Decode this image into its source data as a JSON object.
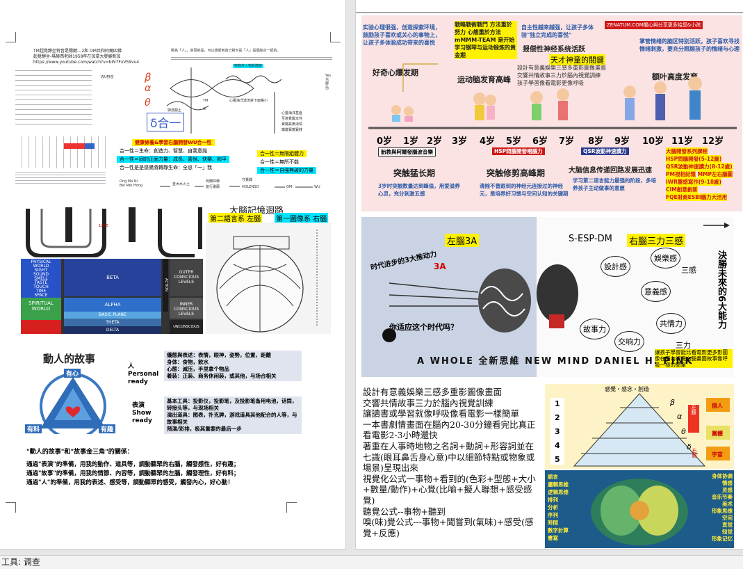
{
  "status": {
    "label": "工具: 调查"
  },
  "left_page": {
    "intro_lines": [
      "TM超覺靜坐特音是關鍵---2和 OM共和阿爾四佛",
      "超覺靜坐-瑪赫西老師1958年在加拿大發展新加",
      "https://www.youtube.com/watch?v=bW7FxV59vv4"
    ],
    "right_intro": "數為「人」，意思就是，可以感受到自己對天是「人」是個綜合一起的。",
    "highlight_note": "物物件人物質體變",
    "diagram": {
      "wu_label": "WU特音",
      "greek": [
        "β",
        "α",
        "θ"
      ],
      "center_label": "δ合一",
      "left_col": [
        "左",
        "腦",
        "知",
        "本",
        "能"
      ],
      "right_col": [
        "右",
        "腦",
        "大",
        "樓",
        "時",
        "空"
      ],
      "wave_label": "弾波靜止",
      "tm": "TM",
      "g": "G",
      "right_notes": [
        "心靈海洋波流就下面格小",
        "心靈海洋基盤",
        "至境覺醒本性",
        "寶鐵鉄無涼情",
        "鐵鍵寶鐵寶錢"
      ],
      "yes_col": [
        "Yes",
        "也",
        "野",
        "治"
      ]
    },
    "bars": [
      {
        "text": "健康修養&學習右腦開發WU合一性",
        "color": "#fff200"
      },
      {
        "text": "合一性＝生命：創造力、智慧、自我意識",
        "color": "#fff"
      },
      {
        "text": "合一性＝同的正面力量：成長、喜悅、快樂、和平",
        "color": "#00e5ff"
      },
      {
        "text": "合一性是是感覺將轉靜生命：全息「一」我",
        "color": "#fff"
      }
    ],
    "bars_right": [
      {
        "text": "合一性＝無限組體力",
        "color": "#fff200"
      },
      {
        "text": "合一性＝無所不能",
        "color": "#fff"
      },
      {
        "text": "合一性＝自強無破的力量",
        "color": "#00e5ff"
      }
    ],
    "flow": {
      "left": [
        "Ong Ma Ni",
        "Bei Mei Hong"
      ],
      "items": [
        "金木水火土",
        "阿爾四佛",
        "能行畫爾",
        "守覺觸",
        "HOLENSO",
        "OM",
        "WU"
      ]
    },
    "memory_title": "大腦記憶迴路",
    "memory_left": "第二語言系 左腦",
    "memory_right": "第一圖像系 右腦",
    "waves": {
      "physical": [
        "PHYSICAL",
        "WORLD",
        "SIGHT",
        "SOUND",
        "SMELL",
        "TASTE",
        "TOUCH",
        "TIME",
        "SPACE"
      ],
      "spiritual": [
        "SPIRITUAL",
        "WORLD"
      ],
      "levels": [
        "BETA",
        "ALPHA",
        "THETA",
        "DELTA"
      ],
      "right": [
        "OUTER CONSCIOUS LEVELS",
        "INNER CONSCIOUS LEVELS",
        "UNCONSCIOUS"
      ],
      "basic": "BASIC PLANE",
      "action": "ACTION",
      "hz": "12HZ"
    },
    "story": {
      "title": "動人的故事",
      "top": "有心",
      "left": "有料",
      "right": "有趣",
      "person_label": "人 Personal ready",
      "show_label": "表演 Show ready",
      "person_points": [
        "儀態與表述：表情，眼神，姿勢，位置，距離",
        "身体：食物，飲水",
        "心態：減压，手里拿个物品",
        "着装：正装、商务休闲装，或其他，与场合相关"
      ],
      "show_points": [
        "基本工具：投影仪，投影笔，及投影笔备用电池，话筒，转接头等，与现场相关",
        "演出道具：图表，扑克牌，游戏道具其他配合的人等，与故事相关",
        "预演/彩排，极其重要的最后一步"
      ],
      "relation_title": "\"動人的故事\"和\"故事金三角\"的關係：",
      "relations": [
        "通過\"表演\"的準備，用我的動作、道具等，調動聽眾的右腦，觸發感性，好有趣；",
        "通過\"故事\"的準備，用我的情節、內容等，調動聽眾的左腦，觸發理性，好有料；",
        "通過\"人\"的準備，用我的表述、感受等，調動聽眾的感受，觸發內心，好心動！"
      ]
    }
  },
  "right_page": {
    "top_blocks": [
      "实验心理很强，创造探索环境，鼓励孩子喜欢或关心的事物上，让孩子多体验成功带来的喜悦",
      "戰略戰術戰鬥 方法重於努力 心態重於方法 mMMM-TEAM 是开始学习钢琴与运动锻炼的黄金期",
      "自主性越来越强，让孩子多体验\"独立完成的喜悦\"",
      "掌管情绪的脑区特别活跃，孩子喜欢寻找情绪刺激，要充分照顾孩子的情绪与心理"
    ],
    "banner": "ZENATUM.COM關心與分享更多給您&小孩",
    "stage_labels": [
      "好奇心爆发期",
      "运动脑发育高峰",
      "报偿性神经系统活跃",
      "额叶高度发育"
    ],
    "talent": "天才神童的關鍵",
    "talent_desc": [
      "設計有意義娛樂三感多重影圖像畫面",
      "交響共情故事三力於腦內視覺訓練",
      "孩子學習像看電影更像呼吸"
    ],
    "ages": [
      "0岁",
      "1岁",
      "2岁",
      "3岁",
      "4岁",
      "5岁",
      "6岁",
      "7岁",
      "8岁",
      "9岁",
      "10岁",
      "11岁",
      "12岁"
    ],
    "tags": [
      "胎教與阿爾發腦波音樂",
      "HSP問腦開發唱腦力",
      "QSR波動神速讀力"
    ],
    "tag_right_title": "大腦開發系列課程",
    "tag_right": [
      "HSP問腦開發(5-12歲)",
      "QSR波動神速讀力(8-12歲)",
      "PM視相記憶",
      "MMP左右腦圖",
      "IWR靈感寫作(9-18歲)",
      "CIM創意創新",
      "FQE財商ESBI腦力大活用"
    ],
    "bottom_stage_titles": [
      "突触猛长期",
      "突触修剪高峰期",
      "大脑信息传递回路发展迅速"
    ],
    "bottom_stage_desc": [
      "3岁时突触数量达到峰值，用爱滋养心灵，充分刺激五感",
      "清除不曾跟到的神经元连接过的神经元，是培养好习惯与空间认知的关键期",
      "学习第二语言能力最强的阶段，多培养孩子主动做事的意愿"
    ],
    "whole_mind": {
      "left_title": "左腦3A",
      "right_title": "右腦三力三感",
      "sespdm": "S-ESP-DM",
      "question": "时代进步的3大推动力",
      "three_a": "3A",
      "bubbles": [
        "設計感",
        "娛樂感",
        "意義感",
        "故事力",
        "交响力",
        "共情力"
      ],
      "decide": "決勝未來的6大能力",
      "san_gan": "三感",
      "san_li": "三力",
      "are_you": "你适应这个时代吗？",
      "footer": "A WHOLE 全新思維 NEW MIND DANIEL H. PINK",
      "note": "讓孩子學習能比看電影更多影圖像在腦內視覺右腦畫面故事像呼吸一樣的簡單"
    },
    "body_text": [
      "設計有意義娛樂三感多重影圖像畫面",
      "交響共情故事三力於腦內視覺訓練",
      "讓讀書或學習就像呼吸像看電影一樣簡單",
      "一本書劇情畫面在腦內20-30分鐘看完比真正看電影2-3小時還快",
      "著重在人事時地物之名詞+動詞+形容詞並在七識(眼耳鼻舌身心意)中以細節特點或物象或場景)呈現出來",
      "視覺化公式一事物+看到的(色彩+型態+大小+數量/動作)+心覺(比喻+擬人聯想+感受感覺)",
      "聽覺公式--事物+聽到",
      "嗅(味)覺公式---事物+聞嘗到(氣味)+感受(感覺+反應)"
    ],
    "pyramid": {
      "header": "感覺・感念・創造",
      "levels": [
        "1",
        "2",
        "3",
        "4",
        "5"
      ],
      "greek": [
        "β",
        "α",
        "θ",
        "δ"
      ],
      "right": [
        "個人",
        "團體",
        "宇宙"
      ],
      "side": [
        "左腦",
        "右腦"
      ]
    },
    "brain_words_left": [
      "語言",
      "邏輯思維",
      "逻辑思维",
      "排列",
      "分析",
      "序列",
      "時間",
      "數字計算",
      "書寫"
    ],
    "brain_words_right": [
      "身体协调",
      "情感",
      "灵感",
      "音乐节奏",
      "美术",
      "形象思维",
      "空间",
      "直觉",
      "知觉",
      "形象记忆"
    ]
  }
}
